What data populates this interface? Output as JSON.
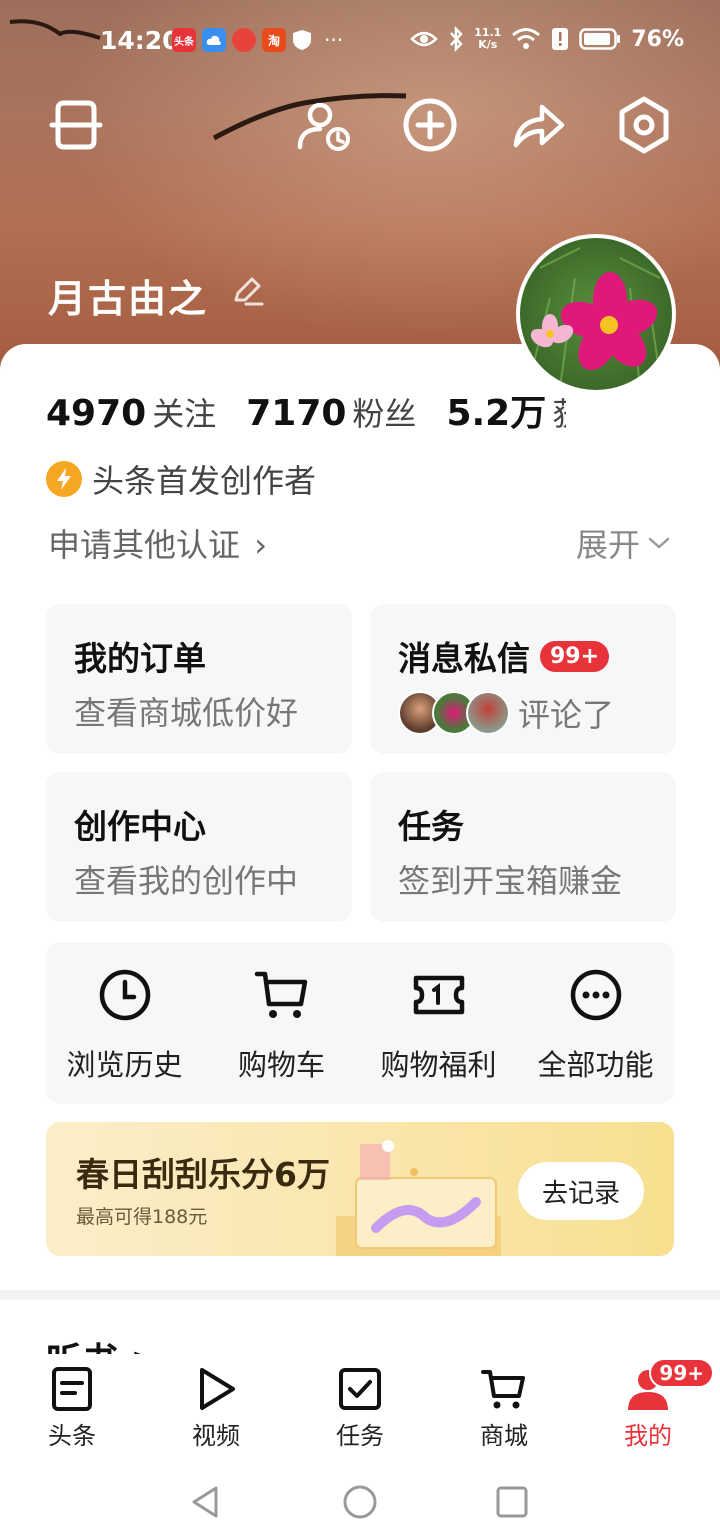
{
  "status_bar": {
    "time": "14:20",
    "apps": [
      {
        "name": "toutiao-app-icon",
        "label": "头条",
        "color": "#e8333a"
      },
      {
        "name": "cloud-app-icon",
        "label": "",
        "color": "#3a8ef0"
      },
      {
        "name": "red-app-icon",
        "label": "",
        "color": "#e8433a"
      },
      {
        "name": "taobao-app-icon",
        "label": "淘",
        "color": "#e84a1a"
      }
    ],
    "more": "···",
    "speed_top": "11.1",
    "speed_bottom": "K/s",
    "battery": "76%"
  },
  "profile": {
    "username": "月古由之",
    "stats": [
      {
        "value": "4970",
        "label": "关注"
      },
      {
        "value": "7170",
        "label": "粉丝"
      },
      {
        "value": "5.2万",
        "label": "获"
      }
    ],
    "creator_badge": "头条首发创作者",
    "apply_cert": "申请其他认证",
    "apply_chevron": "›",
    "expand": "展开"
  },
  "quick_cards": [
    {
      "title": "我的订单",
      "subtitle": "查看商城低价好"
    },
    {
      "title": "消息私信",
      "badge": "99+",
      "subtitle": "评论了"
    },
    {
      "title": "创作中心",
      "subtitle": "查看我的创作中"
    },
    {
      "title": "任务",
      "subtitle": "签到开宝箱赚金"
    }
  ],
  "tools": [
    {
      "label": "浏览历史",
      "icon": "clock-icon"
    },
    {
      "label": "购物车",
      "icon": "cart-icon"
    },
    {
      "label": "购物福利",
      "icon": "ticket-icon"
    },
    {
      "label": "全部功能",
      "icon": "more-icon"
    }
  ],
  "banner": {
    "title": "春日刮刮乐分6万",
    "subtitle": "最高可得188元",
    "button": "去记录"
  },
  "partial_section": "听书 >",
  "tabbar": [
    {
      "label": "头条",
      "icon": "document-icon",
      "active": false
    },
    {
      "label": "视频",
      "icon": "play-icon",
      "active": false
    },
    {
      "label": "任务",
      "icon": "task-check-icon",
      "active": false
    },
    {
      "label": "商城",
      "icon": "cart-icon",
      "active": false
    },
    {
      "label": "我的",
      "icon": "person-icon",
      "active": true,
      "badge": "99+"
    }
  ],
  "colors": {
    "accent": "#e8333a",
    "header": "#a9735d",
    "badge_orange": "#f5a623"
  }
}
